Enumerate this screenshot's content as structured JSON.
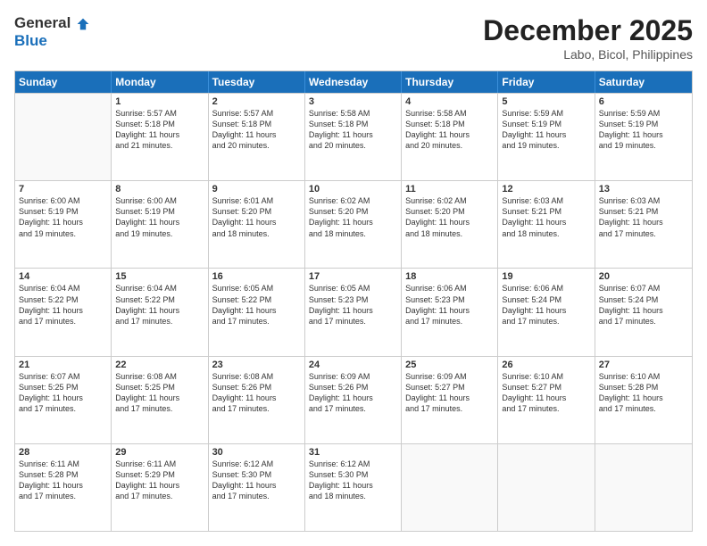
{
  "header": {
    "logo_general": "General",
    "logo_blue": "Blue",
    "month": "December 2025",
    "location": "Labo, Bicol, Philippines"
  },
  "weekdays": [
    "Sunday",
    "Monday",
    "Tuesday",
    "Wednesday",
    "Thursday",
    "Friday",
    "Saturday"
  ],
  "rows": [
    [
      {
        "day": "",
        "info": ""
      },
      {
        "day": "1",
        "info": "Sunrise: 5:57 AM\nSunset: 5:18 PM\nDaylight: 11 hours\nand 21 minutes."
      },
      {
        "day": "2",
        "info": "Sunrise: 5:57 AM\nSunset: 5:18 PM\nDaylight: 11 hours\nand 20 minutes."
      },
      {
        "day": "3",
        "info": "Sunrise: 5:58 AM\nSunset: 5:18 PM\nDaylight: 11 hours\nand 20 minutes."
      },
      {
        "day": "4",
        "info": "Sunrise: 5:58 AM\nSunset: 5:18 PM\nDaylight: 11 hours\nand 20 minutes."
      },
      {
        "day": "5",
        "info": "Sunrise: 5:59 AM\nSunset: 5:19 PM\nDaylight: 11 hours\nand 19 minutes."
      },
      {
        "day": "6",
        "info": "Sunrise: 5:59 AM\nSunset: 5:19 PM\nDaylight: 11 hours\nand 19 minutes."
      }
    ],
    [
      {
        "day": "7",
        "info": "Sunrise: 6:00 AM\nSunset: 5:19 PM\nDaylight: 11 hours\nand 19 minutes."
      },
      {
        "day": "8",
        "info": "Sunrise: 6:00 AM\nSunset: 5:19 PM\nDaylight: 11 hours\nand 19 minutes."
      },
      {
        "day": "9",
        "info": "Sunrise: 6:01 AM\nSunset: 5:20 PM\nDaylight: 11 hours\nand 18 minutes."
      },
      {
        "day": "10",
        "info": "Sunrise: 6:02 AM\nSunset: 5:20 PM\nDaylight: 11 hours\nand 18 minutes."
      },
      {
        "day": "11",
        "info": "Sunrise: 6:02 AM\nSunset: 5:20 PM\nDaylight: 11 hours\nand 18 minutes."
      },
      {
        "day": "12",
        "info": "Sunrise: 6:03 AM\nSunset: 5:21 PM\nDaylight: 11 hours\nand 18 minutes."
      },
      {
        "day": "13",
        "info": "Sunrise: 6:03 AM\nSunset: 5:21 PM\nDaylight: 11 hours\nand 17 minutes."
      }
    ],
    [
      {
        "day": "14",
        "info": "Sunrise: 6:04 AM\nSunset: 5:22 PM\nDaylight: 11 hours\nand 17 minutes."
      },
      {
        "day": "15",
        "info": "Sunrise: 6:04 AM\nSunset: 5:22 PM\nDaylight: 11 hours\nand 17 minutes."
      },
      {
        "day": "16",
        "info": "Sunrise: 6:05 AM\nSunset: 5:22 PM\nDaylight: 11 hours\nand 17 minutes."
      },
      {
        "day": "17",
        "info": "Sunrise: 6:05 AM\nSunset: 5:23 PM\nDaylight: 11 hours\nand 17 minutes."
      },
      {
        "day": "18",
        "info": "Sunrise: 6:06 AM\nSunset: 5:23 PM\nDaylight: 11 hours\nand 17 minutes."
      },
      {
        "day": "19",
        "info": "Sunrise: 6:06 AM\nSunset: 5:24 PM\nDaylight: 11 hours\nand 17 minutes."
      },
      {
        "day": "20",
        "info": "Sunrise: 6:07 AM\nSunset: 5:24 PM\nDaylight: 11 hours\nand 17 minutes."
      }
    ],
    [
      {
        "day": "21",
        "info": "Sunrise: 6:07 AM\nSunset: 5:25 PM\nDaylight: 11 hours\nand 17 minutes."
      },
      {
        "day": "22",
        "info": "Sunrise: 6:08 AM\nSunset: 5:25 PM\nDaylight: 11 hours\nand 17 minutes."
      },
      {
        "day": "23",
        "info": "Sunrise: 6:08 AM\nSunset: 5:26 PM\nDaylight: 11 hours\nand 17 minutes."
      },
      {
        "day": "24",
        "info": "Sunrise: 6:09 AM\nSunset: 5:26 PM\nDaylight: 11 hours\nand 17 minutes."
      },
      {
        "day": "25",
        "info": "Sunrise: 6:09 AM\nSunset: 5:27 PM\nDaylight: 11 hours\nand 17 minutes."
      },
      {
        "day": "26",
        "info": "Sunrise: 6:10 AM\nSunset: 5:27 PM\nDaylight: 11 hours\nand 17 minutes."
      },
      {
        "day": "27",
        "info": "Sunrise: 6:10 AM\nSunset: 5:28 PM\nDaylight: 11 hours\nand 17 minutes."
      }
    ],
    [
      {
        "day": "28",
        "info": "Sunrise: 6:11 AM\nSunset: 5:28 PM\nDaylight: 11 hours\nand 17 minutes."
      },
      {
        "day": "29",
        "info": "Sunrise: 6:11 AM\nSunset: 5:29 PM\nDaylight: 11 hours\nand 17 minutes."
      },
      {
        "day": "30",
        "info": "Sunrise: 6:12 AM\nSunset: 5:30 PM\nDaylight: 11 hours\nand 17 minutes."
      },
      {
        "day": "31",
        "info": "Sunrise: 6:12 AM\nSunset: 5:30 PM\nDaylight: 11 hours\nand 18 minutes."
      },
      {
        "day": "",
        "info": ""
      },
      {
        "day": "",
        "info": ""
      },
      {
        "day": "",
        "info": ""
      }
    ]
  ]
}
